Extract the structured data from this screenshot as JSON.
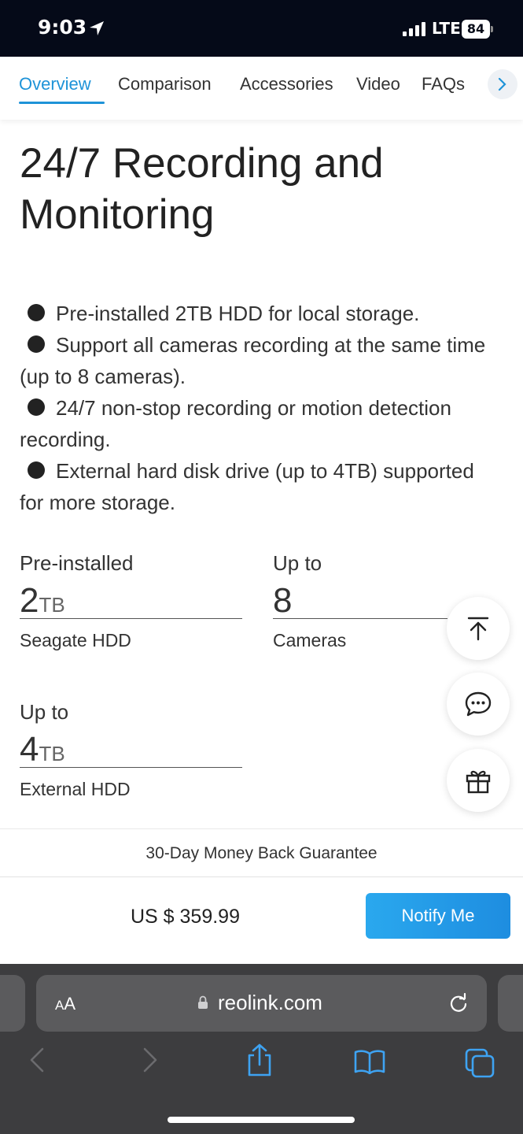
{
  "status_bar": {
    "time": "9:03",
    "network": "LTE",
    "battery": "84"
  },
  "tabs": [
    {
      "label": "Overview",
      "active": true
    },
    {
      "label": "Comparison",
      "active": false
    },
    {
      "label": "Accessories",
      "active": false
    },
    {
      "label": "Video",
      "active": false
    },
    {
      "label": "FAQs",
      "active": false
    }
  ],
  "section": {
    "title": "24/7 Recording and Monitoring",
    "features": [
      "Pre-installed 2TB HDD for local storage.",
      "Support all cameras recording at the same time (up to 8 cameras).",
      "24/7 non-stop recording or motion detection recording.",
      "External hard disk drive (up to 4TB) supported for more storage."
    ],
    "stats": [
      {
        "top": "Pre-installed",
        "value": "2",
        "unit": "TB",
        "bottom": "Seagate HDD"
      },
      {
        "top": "Up to",
        "value": "8",
        "unit": "",
        "bottom": "Cameras"
      },
      {
        "top": "Up to",
        "value": "4",
        "unit": "TB",
        "bottom": "External HDD"
      }
    ]
  },
  "fab": {
    "scroll_top": "arrow-up-to-top-icon",
    "chat": "chat-bubble-icon",
    "gift": "gift-icon"
  },
  "guarantee": "30-Day Money Back Guarantee",
  "purchase": {
    "price": "US $ 359.99",
    "button": "Notify Me"
  },
  "browser": {
    "aa_small": "A",
    "aa_large": "A",
    "url": "reolink.com"
  },
  "colors": {
    "accent": "#1e93d8",
    "status_bar": "#050a18",
    "browser_chrome": "#3d3d3f"
  }
}
